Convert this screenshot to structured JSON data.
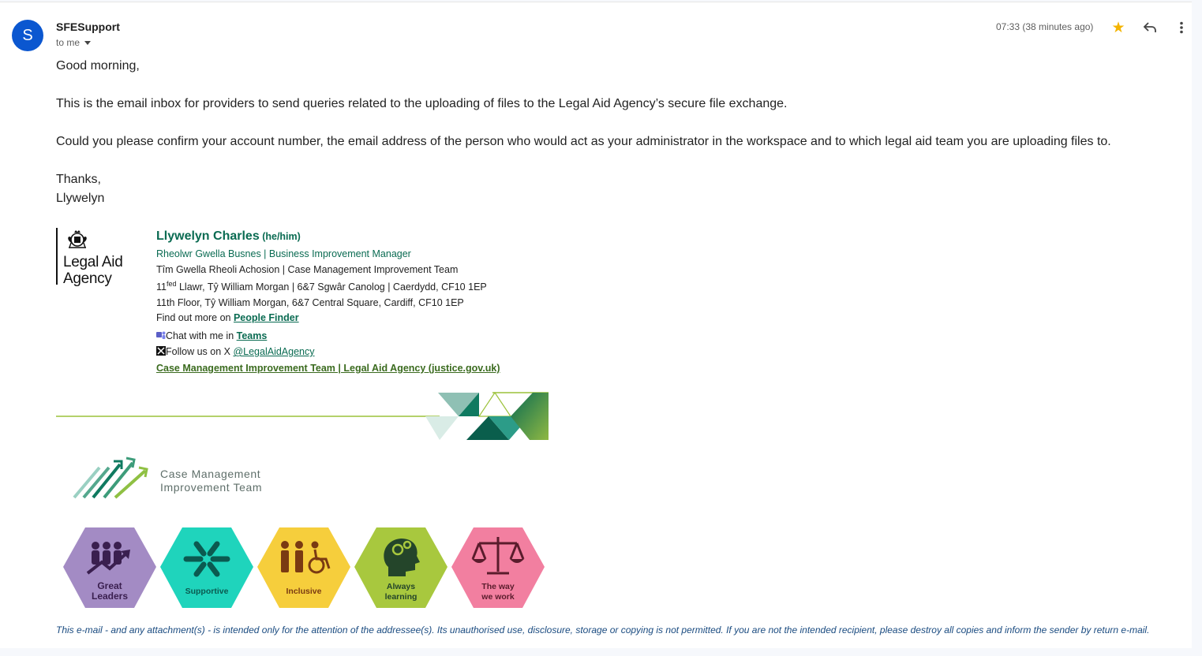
{
  "header": {
    "avatar_letter": "S",
    "sender": "SFESupport",
    "recipient": "to me",
    "timestamp": "07:33 (38 minutes ago)",
    "icons": {
      "star": "star-icon",
      "reply": "reply-icon",
      "more": "more-vert-icon"
    },
    "star_color": "#f4b400"
  },
  "body": {
    "greeting": "Good morning,",
    "paragraph1": "This is the email inbox for providers to send queries related to the uploading of files to the Legal Aid Agency’s secure file exchange.",
    "paragraph2": "Could you please confirm your account number, the email address of the person who would act as your administrator in the workspace and to which legal aid team you are uploading files to.",
    "signoff": "Thanks,",
    "signname": "Llywelyn"
  },
  "signature": {
    "logo_line1": "Legal Aid",
    "logo_line2": "Agency",
    "name": "Llywelyn Charles",
    "pronouns": "(he/him)",
    "role": "Rheolwr Gwella Busnes | Business Improvement Manager",
    "team": "Tîm Gwella Rheoli Achosion | Case Management Improvement Team",
    "address_welsh_num": "11",
    "address_welsh_sup": "fed",
    "address_welsh_rest": " Llawr, Tŷ William Morgan | 6&7 Sgwâr Canolog | Caerdydd, CF10 1EP",
    "address_english": "11th Floor, Tŷ William Morgan, 6&7 Central Square, Cardiff, CF10 1EP",
    "find_out_prefix": "Find out more on ",
    "find_out_link": "People Finder",
    "chat_prefix": "Chat with me in ",
    "chat_link": "Teams",
    "follow_prefix": "Follow us on X ",
    "follow_link": "@LegalAidAgency",
    "team_link": "Case Management Improvement Team | Legal Aid Agency (justice.gov.uk)",
    "cmit_line1": "Case Management",
    "cmit_line2": "Improvement Team",
    "values": [
      {
        "line1": "Great",
        "line2": "Leaders",
        "color": "#a38bc4"
      },
      {
        "line1": "Supportive",
        "line2": "",
        "color": "#1fd4bc"
      },
      {
        "line1": "Inclusive",
        "line2": "",
        "color": "#f6ce3c"
      },
      {
        "line1": "Always",
        "line2": "learning",
        "color": "#a8c83e"
      },
      {
        "line1": "The way",
        "line2": "we work",
        "color": "#f27fa0"
      }
    ]
  },
  "disclaimer": "This e-mail - and any attachment(s) - is intended only for the attention of the addressee(s). Its unauthorised use, disclosure, storage or copying is not permitted. If you are not the intended recipient, please destroy all copies and inform the sender by return e-mail."
}
